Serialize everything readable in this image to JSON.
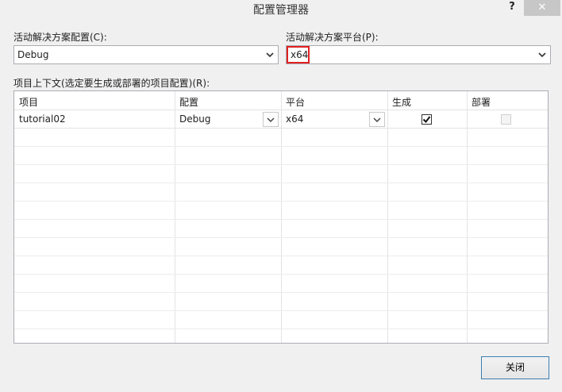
{
  "window": {
    "title": "配置管理器",
    "help_label": "?",
    "close_label": "✕"
  },
  "solution_config": {
    "label": "活动解决方案配置(C):",
    "value": "Debug"
  },
  "solution_platform": {
    "label": "活动解决方案平台(P):",
    "value": "x64",
    "highlight_color": "#e02020"
  },
  "project_contexts": {
    "label": "项目上下文(选定要生成或部署的项目配置)(R):",
    "columns": [
      "项目",
      "配置",
      "平台",
      "生成",
      "部署"
    ],
    "rows": [
      {
        "project": "tutorial02",
        "config": "Debug",
        "platform": "x64",
        "build": true,
        "deploy": false
      }
    ]
  },
  "buttons": {
    "close": "关闭"
  }
}
